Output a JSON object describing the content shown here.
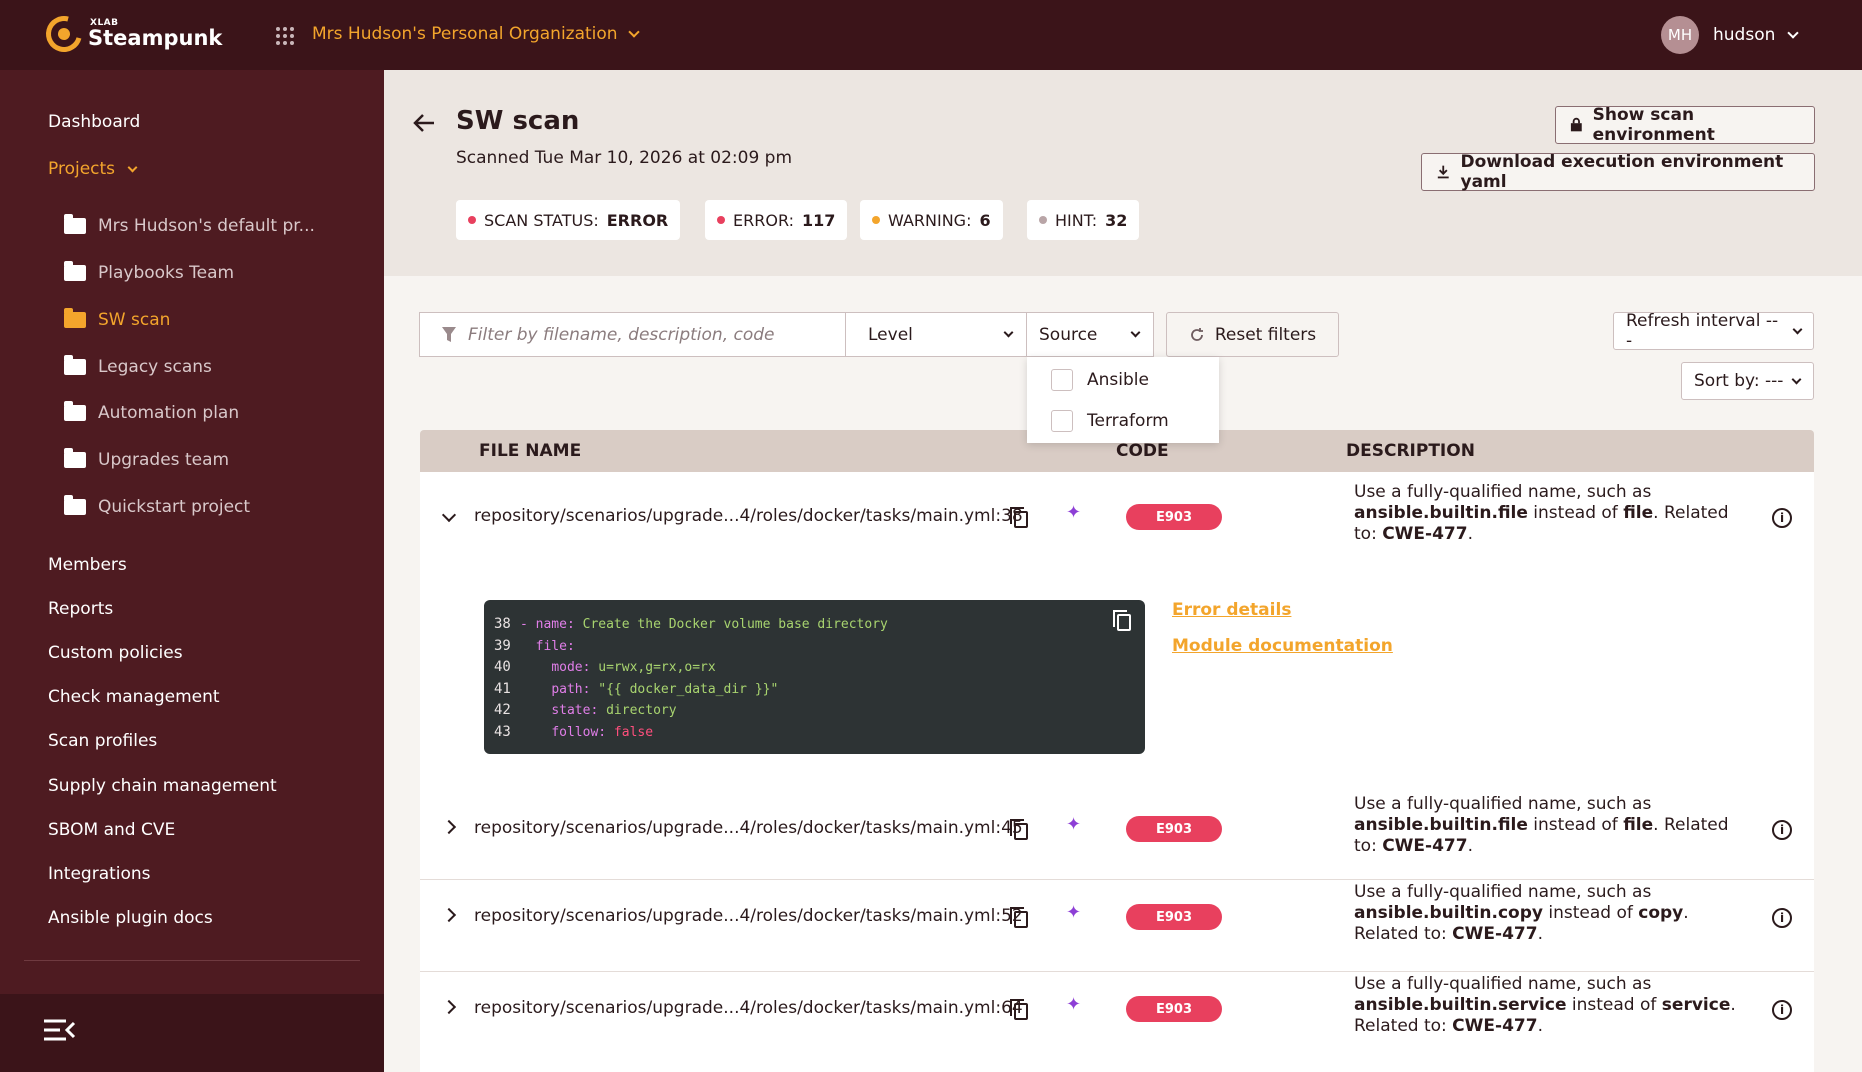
{
  "topbar": {
    "logo_small": "XLAB",
    "logo_big": "Steampunk",
    "organization": "Mrs Hudson's Personal Organization",
    "avatar_initials": "MH",
    "username": "hudson"
  },
  "sidebar": {
    "dashboard": "Dashboard",
    "projects": "Projects",
    "project_items": [
      "Mrs Hudson's default pr...",
      "Playbooks Team",
      "SW scan",
      "Legacy scans",
      "Automation plan",
      "Upgrades team",
      "Quickstart project"
    ],
    "active_project": "SW scan",
    "nav_items": [
      "Members",
      "Reports",
      "Custom policies",
      "Check management",
      "Scan profiles",
      "Supply chain management",
      "SBOM and CVE",
      "Integrations",
      "Ansible plugin docs"
    ]
  },
  "header": {
    "title": "SW scan",
    "scanned": "Scanned Tue Mar 10, 2026 at 02:09 pm",
    "show_env_button": "Show scan environment",
    "download_button": "Download execution environment yaml",
    "stats": [
      {
        "label": "SCAN STATUS:",
        "value": "ERROR",
        "color": "#e8405e"
      },
      {
        "label": "ERROR:",
        "value": "117",
        "color": "#e8405e"
      },
      {
        "label": "WARNING:",
        "value": "6",
        "color": "#f3a52c"
      },
      {
        "label": "HINT:",
        "value": "32",
        "color": "#b9a5a7"
      }
    ]
  },
  "filters": {
    "search_placeholder": "Filter by filename, description, code",
    "level_label": "Level",
    "source_label": "Source",
    "reset_label": "Reset filters",
    "refresh_label": "Refresh interval ---",
    "sort_label": "Sort by: ---",
    "source_options": [
      "Ansible",
      "Terraform"
    ]
  },
  "table": {
    "headers": {
      "file_name": "FILE NAME",
      "code": "CODE",
      "description": "DESCRIPTION"
    },
    "rows": [
      {
        "file": "repository/scenarios/upgrade...4/roles/docker/tasks/main.yml:38",
        "code": "E903",
        "desc_pre": "Use a fully-qualified name, such as ",
        "desc_fq": "ansible.builtin.file",
        "desc_mid": " instead of ",
        "desc_mod": "file",
        "desc_rel": ". Related to: ",
        "desc_cwe": "CWE-477",
        "desc_end": "."
      },
      {
        "file": "repository/scenarios/upgrade...4/roles/docker/tasks/main.yml:45",
        "code": "E903",
        "desc_pre": "Use a fully-qualified name, such as ",
        "desc_fq": "ansible.builtin.file",
        "desc_mid": " instead of ",
        "desc_mod": "file",
        "desc_rel": ". Related to: ",
        "desc_cwe": "CWE-477",
        "desc_end": "."
      },
      {
        "file": "repository/scenarios/upgrade...4/roles/docker/tasks/main.yml:52",
        "code": "E903",
        "desc_pre": "Use a fully-qualified name, such as ",
        "desc_fq": "ansible.builtin.copy",
        "desc_mid": " instead of ",
        "desc_mod": "copy",
        "desc_rel": ". Related to: ",
        "desc_cwe": "CWE-477",
        "desc_end": "."
      },
      {
        "file": "repository/scenarios/upgrade...4/roles/docker/tasks/main.yml:64",
        "code": "E903",
        "desc_pre": "Use a fully-qualified name, such as ",
        "desc_fq": "ansible.builtin.service",
        "desc_mid": " instead of ",
        "desc_mod": "service",
        "desc_rel": ". Related to: ",
        "desc_cwe": "CWE-477",
        "desc_end": "."
      }
    ],
    "expanded": {
      "code_lines": [
        {
          "n": "38",
          "key": "- name:",
          "val": " Create the Docker volume base directory",
          "indent": ""
        },
        {
          "n": "39",
          "key": "file:",
          "val": "",
          "indent": "  "
        },
        {
          "n": "40",
          "key": "mode:",
          "val": " u=rwx,g=rx,o=rx",
          "indent": "    "
        },
        {
          "n": "41",
          "key": "path:",
          "val": " \"{{ docker_data_dir }}\"",
          "indent": "    "
        },
        {
          "n": "42",
          "key": "state:",
          "val": " directory",
          "indent": "    "
        },
        {
          "n": "43",
          "key": "follow:",
          "val": " false",
          "indent": "    "
        }
      ],
      "error_details": "Error details",
      "module_docs": "Module documentation"
    }
  }
}
